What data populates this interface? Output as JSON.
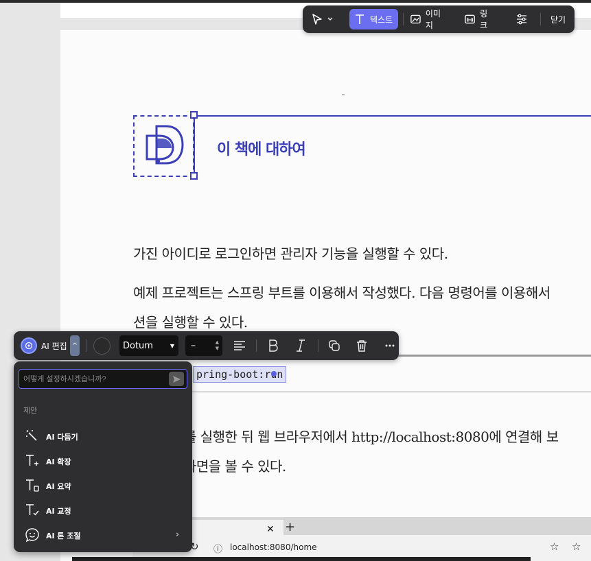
{
  "top_toolbar": {
    "text_label": "텍스트",
    "image_label": "이미지",
    "link_label": "링크",
    "close_label": "닫기"
  },
  "document": {
    "chapter_title": "이 책에 대하여",
    "para1": "가진 아이디로 로그인하면 관리자 기능을 실행할 수 있다.",
    "para2_line1": "예제 프로젝트는 스프링 부트를 이용해서 작성했다. 다음 명령어를 이용해서",
    "para2_line2": "션을 실행할 수 있다.",
    "code": "pring-boot:run",
    "para3_line1": "를 실행한 뒤 웹 브라우저에서 http://localhost:8080에 연결해 보",
    "para3_line2": "화면을 볼 수 있다."
  },
  "browser_screenshot": {
    "tab_fragment": "ㅏ",
    "url": "localhost:8080/home"
  },
  "format_toolbar": {
    "ai_edit_label": "AI 편집",
    "font_value": "Dotum",
    "size_value": "–"
  },
  "ai_panel": {
    "input_placeholder": "어떻게 설정하시겠습니까?",
    "section_label": "제안",
    "items": [
      {
        "label": "AI 다듬기"
      },
      {
        "label": "AI 확장"
      },
      {
        "label": "AI 요약"
      },
      {
        "label": "AI 교정"
      },
      {
        "label": "AI 톤 조절"
      }
    ]
  },
  "colors": {
    "accent": "#6b6ef0",
    "brand_blue": "#3a3fb8",
    "toolbar_bg": "#2e2e31"
  }
}
